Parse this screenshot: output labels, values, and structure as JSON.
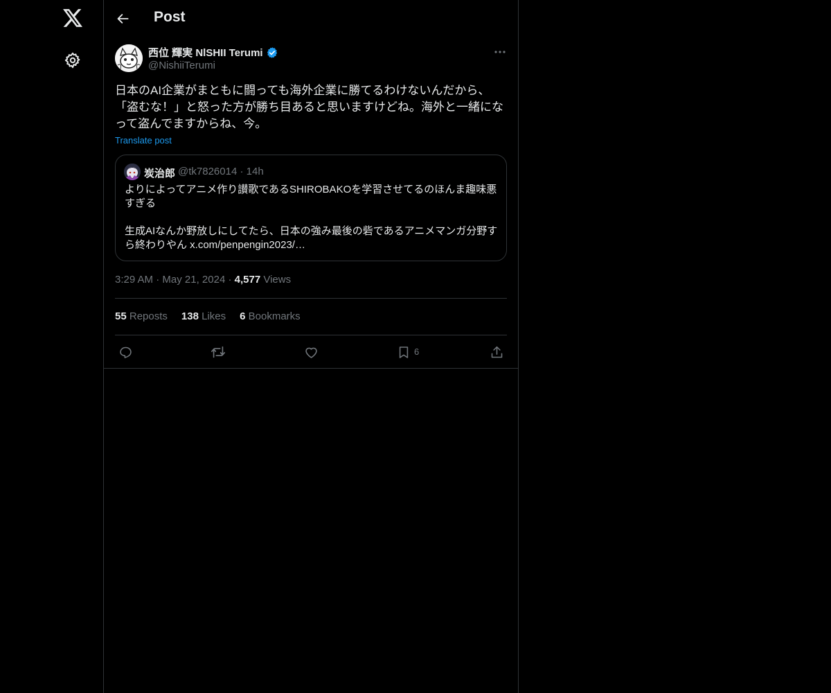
{
  "nav": {
    "logo_icon": "x-logo-icon",
    "settings_icon": "gear-icon"
  },
  "header": {
    "title": "Post",
    "back_icon": "arrow-left-icon"
  },
  "post": {
    "author_name": "西位 輝実 NlSHII Terumi",
    "author_handle": "@NishiiTerumi",
    "verified": true,
    "text_lines": [
      "日本のAI企業がまともに闘っても海外企業に勝てるわけないんだから、",
      "「盗むな！」と怒った方が勝ち目あると思いますけどね。海外と一緒にな",
      "って盗んでますからね、今。"
    ],
    "translate_label": "Translate post",
    "time": "3:29 AM",
    "date": "May 21, 2024",
    "views_count": "4,577",
    "views_label": "Views"
  },
  "quote": {
    "name": "炭治郎",
    "handle": "@tk7826014",
    "age": "14h",
    "lines": [
      "よりによってアニメ作り讃歌であるSHIROBAKOを学習させてるのほんま趣味悪",
      "すぎる",
      "",
      "生成AIなんか野放しにしてたら、日本の強み最後の砦であるアニメマンガ分野す",
      "ら終わりやん x.com/penpengin2023/…"
    ]
  },
  "stats": {
    "reposts_count": "55",
    "reposts_label": "Reposts",
    "likes_count": "138",
    "likes_label": "Likes",
    "bookmarks_count": "6",
    "bookmarks_label": "Bookmarks"
  },
  "actions": {
    "bookmark_count": "6"
  },
  "colors": {
    "accent": "#1d9bf0",
    "background": "#000000",
    "border": "#2f3336",
    "secondary_text": "#71767b"
  }
}
